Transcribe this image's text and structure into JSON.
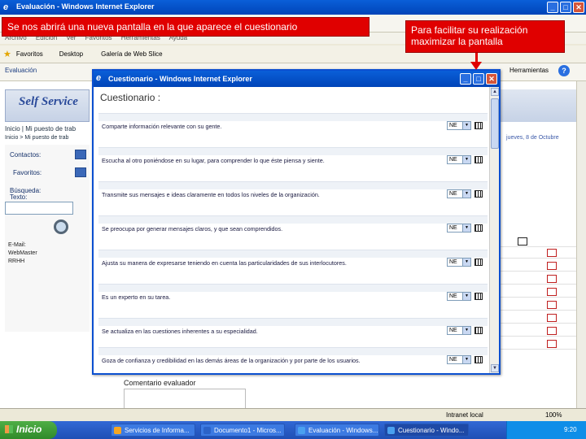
{
  "bg_window": {
    "title": "Evaluación - Windows Internet Explorer",
    "menu": [
      "Archivo",
      "Edición",
      "Ver",
      "Favoritos",
      "Herramientas",
      "Ayuda"
    ],
    "favorites_label": "Favoritos",
    "fav_links": [
      "Desktop",
      "Galería de Web Slice"
    ],
    "tab_label": "Evaluación",
    "tools_label": "Herramientas"
  },
  "page": {
    "logo_text": "Self Service",
    "breadcrumb1": "Inicio  |  Mi puesto de trab",
    "breadcrumb2": "Inicio > Mi puesto de trab",
    "date_text": "jueves, 8 de Octubre",
    "left_panel": {
      "contacts": "Contactos:",
      "favorites": "Favoritos:",
      "search_label": "Búsqueda:",
      "text_label": "Texto:",
      "contact_rows": [
        "E-Mail:",
        "WebMaster",
        "RRHH"
      ]
    },
    "comment_label": "Comentario evaluador"
  },
  "statusbar": {
    "zone": "Intranet local",
    "zoom": "100%"
  },
  "taskbar": {
    "start_label": "Inicio",
    "items": [
      "Servicios de Informa...",
      "Documento1 - Micros...",
      "Evaluación - Windows...",
      "Cuestionario - Windo..."
    ],
    "clock": "9:20"
  },
  "popup": {
    "title": "Cuestionario - Windows Internet Explorer",
    "heading": "Cuestionario :",
    "questions": [
      "Comparte información relevante con su gente.",
      "Escucha al otro poniéndose en su lugar, para comprender lo que éste piensa y siente.",
      "Transmite sus mensajes e ideas claramente en todos los niveles de la organización.",
      "Se preocupa por generar mensajes claros, y que sean comprendidos.",
      "Ajusta su manera de expresarse teniendo en cuenta las particularidades de sus interlocutores.",
      "Es un experto en su tarea.",
      "Se actualiza en las cuestiones inherentes a su especialidad.",
      "Goza de confianza y credibilidad en las demás áreas de la organización y por parte de los usuarios."
    ],
    "select_value": "NE"
  },
  "callouts": {
    "left": "Se nos abrirá una nueva pantalla en la que aparece el cuestionario",
    "right": "Para facilitar su realización maximizar la pantalla"
  },
  "colors": {
    "callout_red": "#e00000",
    "xp_blue": "#0a5fd8",
    "start_green": "#3f9e38"
  }
}
